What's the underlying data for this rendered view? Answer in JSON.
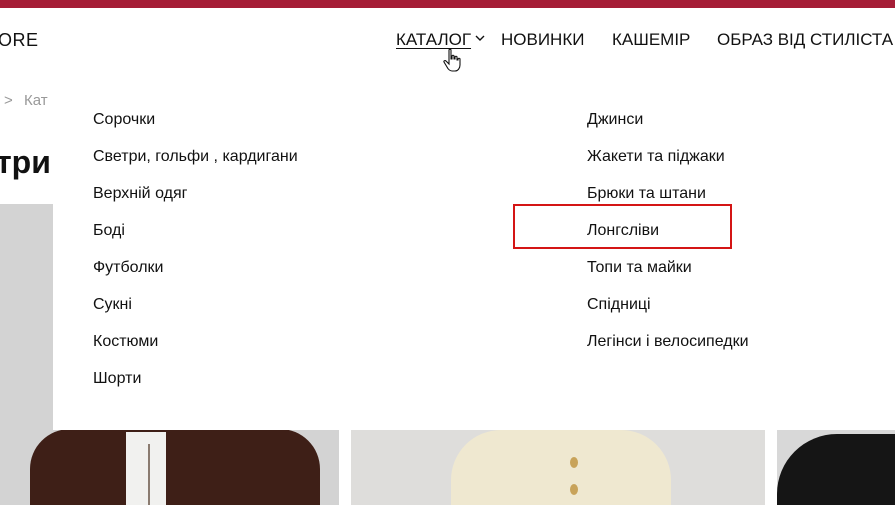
{
  "header": {
    "logo_text": "ORE",
    "nav": [
      {
        "label": "КАТАЛОГ",
        "has_dropdown": true,
        "active": true
      },
      {
        "label": "НОВИНКИ"
      },
      {
        "label": "КАШЕМІР"
      },
      {
        "label": "ОБРАЗ ВІД СТИЛІСТА"
      }
    ],
    "accent_color": "#a51d36"
  },
  "breadcrumb": {
    "separator": ">",
    "current": "Кат"
  },
  "page_title": "три",
  "dropdown": {
    "left_items": [
      "Сорочки",
      "Светри, гольфи , кардигани",
      "Верхній одяг",
      "Боді",
      "Футболки",
      "Сукні",
      "Костюми",
      "Шорти"
    ],
    "right_items": [
      "Джинси",
      "Жакети та піджаки",
      "Брюки та штани",
      "Лонгсліви",
      "Топи та майки",
      "Спідниці",
      "Легінси і велосипедки"
    ],
    "highlighted_item": "Лонгсліви",
    "highlight_color": "#d41515"
  },
  "icons": {
    "chevron": "chevron-down-icon",
    "cursor": "hand-pointer-icon"
  }
}
